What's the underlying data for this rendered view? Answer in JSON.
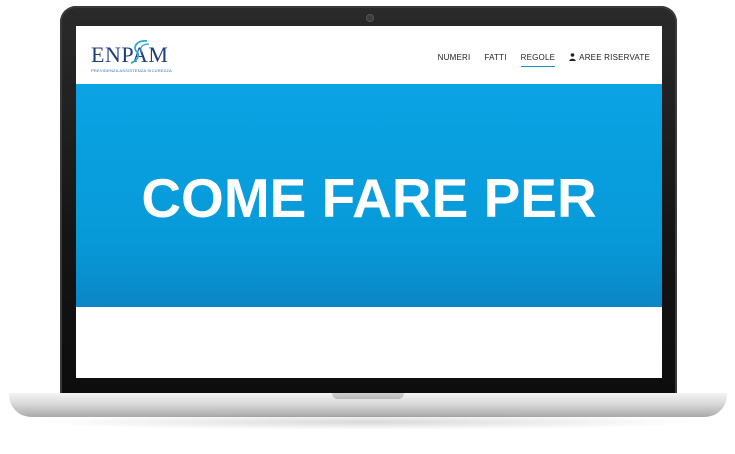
{
  "site": {
    "logo": {
      "name": "ENPAM",
      "tagline": "PREVIDENZA ASSISTENZA SICUREZZA"
    },
    "nav": {
      "items": [
        "NUMERI",
        "FATTI",
        "REGOLE",
        "AREE RISERVATE"
      ],
      "active": "REGOLE"
    },
    "hero": {
      "title": "COME FARE PER"
    }
  },
  "colors": {
    "hero_bg": "#079ad9",
    "brand_navy": "#1f3f7a",
    "active_underline": "#1d8fd1"
  },
  "icons": {
    "aree_riservate": "user-icon"
  }
}
